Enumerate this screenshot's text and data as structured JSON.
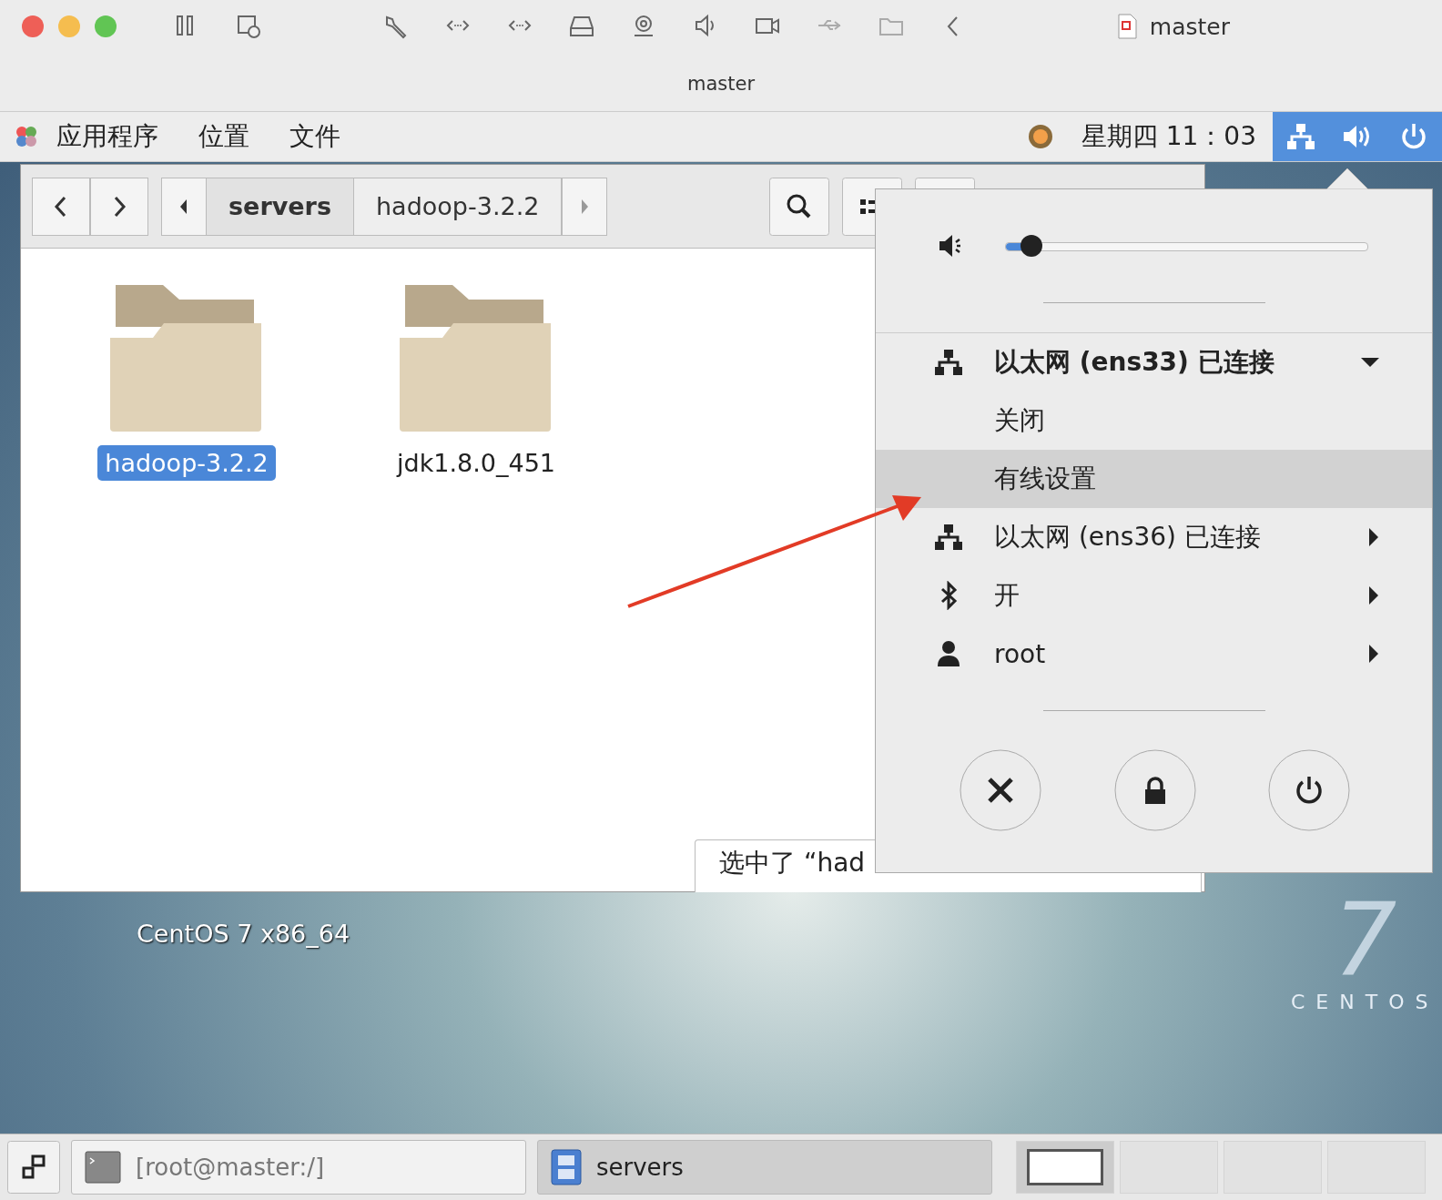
{
  "host_window": {
    "toolbar_title": "master",
    "title": "master"
  },
  "top_bar": {
    "menus": [
      "应用程序",
      "位置",
      "文件"
    ],
    "clock": "星期四 11：03"
  },
  "file_manager": {
    "path": [
      {
        "label": "servers",
        "selected": true
      },
      {
        "label": "hadoop-3.2.2",
        "selected": false
      }
    ],
    "files": [
      {
        "name": "hadoop-3.2.2",
        "selected": true
      },
      {
        "name": "jdk1.8.0_451",
        "selected": false
      }
    ],
    "status": "选中了 “had"
  },
  "system_menu": {
    "volume": {
      "level": 0.07
    },
    "items": [
      {
        "kind": "network",
        "label": "以太网 (ens33) 已连接",
        "expanded": true,
        "children": [
          {
            "label": "关闭",
            "selected": false
          },
          {
            "label": "有线设置",
            "selected": true
          }
        ]
      },
      {
        "kind": "network",
        "label": "以太网 (ens36) 已连接",
        "expanded": false
      },
      {
        "kind": "bluetooth",
        "label": "开",
        "expanded": false
      },
      {
        "kind": "user",
        "label": "root",
        "expanded": false
      }
    ]
  },
  "desktop": {
    "os_label": "CentOS 7 x86_64",
    "logo_number": "7",
    "logo_text": "CENTOS"
  },
  "taskbar": {
    "tasks": [
      {
        "kind": "terminal",
        "label": "[root@master:/]",
        "selected": false
      },
      {
        "kind": "files",
        "label": "servers",
        "selected": true
      }
    ],
    "workspaces": [
      {
        "selected": true
      },
      {
        "selected": false
      },
      {
        "selected": false
      },
      {
        "selected": false
      }
    ]
  }
}
